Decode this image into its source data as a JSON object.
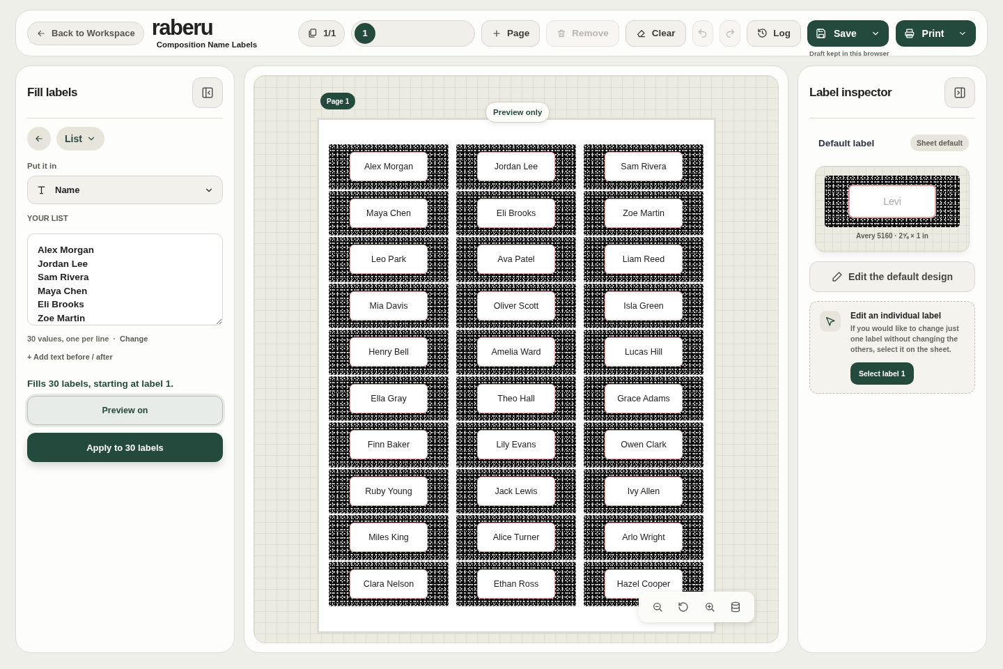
{
  "topbar": {
    "back_button": "Back to Workspace",
    "logo": "raberu",
    "subtitle": "Composition Name Labels",
    "page_count": "1/1",
    "page_tabs": [
      {
        "label": "1",
        "selected": true
      }
    ],
    "actions": [
      {
        "kind": "add",
        "label": "Page",
        "disabled": false
      },
      {
        "kind": "remove",
        "label": "Remove",
        "disabled": true
      },
      {
        "kind": "clear",
        "label": "Clear",
        "disabled": false
      }
    ],
    "history": [
      {
        "kind": "undo",
        "disabled": true
      },
      {
        "kind": "redo",
        "disabled": true
      }
    ],
    "log_button": "Log",
    "save_button": "Save",
    "save_note": "Draft kept in this browser",
    "print_button": "Print"
  },
  "fill_panel": {
    "title": "Fill labels",
    "mode_button": "List",
    "put_it_in_label": "Put it in",
    "field_select": "Name",
    "your_list_label": "YOUR LIST",
    "list_value": "Alex Morgan\nJordan Lee\nSam Rivera\nMaya Chen\nEli Brooks\nZoe Martin",
    "count_note": "30 values, one per line",
    "separator": "·",
    "change_link": "Change",
    "add_text_link": "+ Add text before / after",
    "fills_note": "Fills 30 labels, starting at label 1.",
    "preview_button": "Preview on",
    "apply_button": "Apply to 30 labels"
  },
  "sheet": {
    "page_badge": "Page 1",
    "preview_badge": "Preview only",
    "labels": [
      "Alex Morgan",
      "Jordan Lee",
      "Sam Rivera",
      "Maya Chen",
      "Eli Brooks",
      "Zoe Martin",
      "Leo Park",
      "Ava Patel",
      "Liam Reed",
      "Mia Davis",
      "Oliver Scott",
      "Isla Green",
      "Henry Bell",
      "Amelia Ward",
      "Lucas Hill",
      "Ella Gray",
      "Theo Hall",
      "Grace Adams",
      "Finn Baker",
      "Lily Evans",
      "Owen Clark",
      "Ruby Young",
      "Jack Lewis",
      "Ivy Allen",
      "Miles King",
      "Alice Turner",
      "Arlo Wright",
      "Clara Nelson",
      "Ethan Ross",
      "Hazel Cooper"
    ]
  },
  "inspector": {
    "title": "Label inspector",
    "default_label": "Default label",
    "badge": "Sheet default",
    "preview_name": "Levi",
    "preview_caption": "Avery 5160 · 2⅝ × 1 in",
    "edit_button": "Edit the default design",
    "individual_title": "Edit an individual label",
    "individual_text": "If you would like to change just one label without changing the others, select it on the sheet.",
    "select_button": "Select label 1"
  }
}
